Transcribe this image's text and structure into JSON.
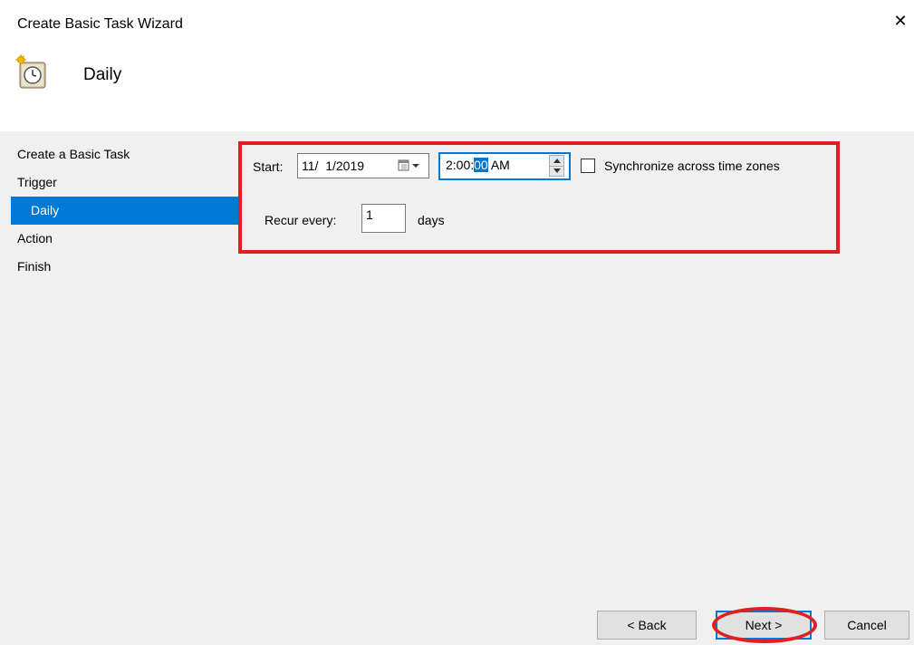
{
  "window": {
    "title": "Create Basic Task Wizard",
    "close_glyph": "✕"
  },
  "header": {
    "icon": "clock-icon",
    "heading": "Daily"
  },
  "sidebar": {
    "steps": [
      {
        "label": "Create a Basic Task"
      },
      {
        "label": "Trigger"
      },
      {
        "label": "Daily",
        "active": true
      },
      {
        "label": "Action"
      },
      {
        "label": "Finish"
      }
    ]
  },
  "form": {
    "start_label": "Start:",
    "start_date": "11/  1/2019",
    "start_time_prefix": "2:00:",
    "start_time_selected": "00",
    "start_time_suffix": " AM",
    "sync_label": "Synchronize across time zones",
    "sync_checked": false,
    "recur_label": "Recur every:",
    "recur_value": "1",
    "recur_unit": "days"
  },
  "buttons": {
    "back": "< Back",
    "next": "Next >",
    "cancel": "Cancel"
  },
  "colors": {
    "accent": "#0078d7",
    "annotation": "#e02020"
  }
}
